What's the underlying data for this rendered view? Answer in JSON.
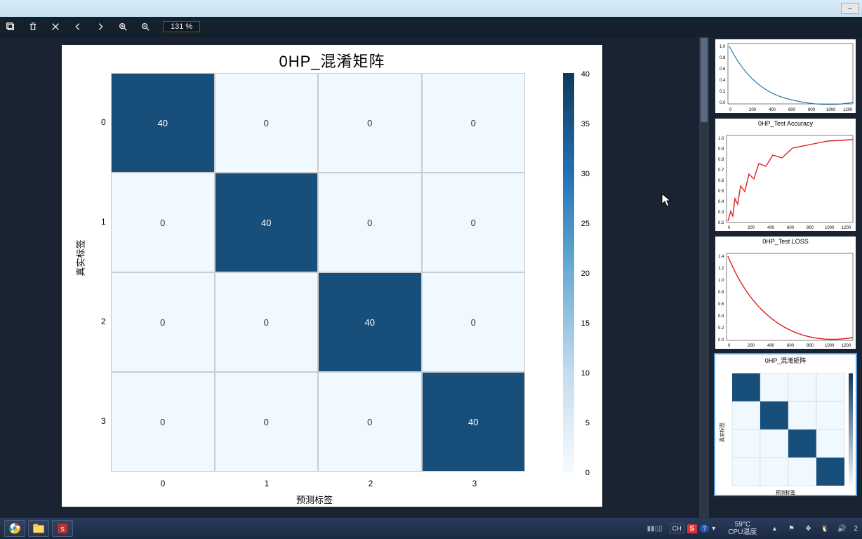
{
  "toolbar": {
    "zoom_text": "131 %"
  },
  "chart_data": {
    "type": "heatmap",
    "title": "0HP_混淆矩阵",
    "xlabel": "预测标签",
    "ylabel": "真实标签",
    "x_ticks": [
      "0",
      "1",
      "2",
      "3"
    ],
    "y_ticks": [
      "0",
      "1",
      "2",
      "3"
    ],
    "matrix": [
      [
        40,
        0,
        0,
        0
      ],
      [
        0,
        40,
        0,
        0
      ],
      [
        0,
        0,
        40,
        0
      ],
      [
        0,
        0,
        0,
        40
      ]
    ],
    "colorbar": {
      "ticks": [
        0,
        5,
        10,
        15,
        20,
        25,
        30,
        35,
        40
      ]
    }
  },
  "side_charts": [
    {
      "title": "",
      "type": "line",
      "color": "#2a7aae",
      "yticks": [
        "0.0",
        "0.2",
        "0.4",
        "0.6",
        "0.8",
        "1.0"
      ],
      "xticks": [
        "0",
        "200",
        "400",
        "600",
        "800",
        "1000",
        "1200"
      ],
      "note": "decaying curve (partially visible)"
    },
    {
      "title": "0HP_Test Accuracy",
      "type": "line",
      "color": "#e02020",
      "yticks": [
        "0.2",
        "0.3",
        "0.4",
        "0.5",
        "0.6",
        "0.7",
        "0.8",
        "0.9",
        "1.0"
      ],
      "xticks": [
        "0",
        "200",
        "400",
        "600",
        "800",
        "1000",
        "1200"
      ],
      "note": "rising curve approaching 1.0"
    },
    {
      "title": "0HP_Test LOSS",
      "type": "line",
      "color": "#e02020",
      "yticks": [
        "0.0",
        "0.2",
        "0.4",
        "0.6",
        "0.8",
        "1.0",
        "1.2",
        "1.4"
      ],
      "xticks": [
        "0",
        "200",
        "400",
        "600",
        "800",
        "1000",
        "1200"
      ],
      "note": "falling curve from ~1.4 toward 0"
    },
    {
      "title": "0HP_混淆矩阵",
      "type": "heatmap",
      "matrix": [
        [
          40,
          0,
          0,
          0
        ],
        [
          0,
          40,
          0,
          0
        ],
        [
          0,
          0,
          40,
          0
        ],
        [
          0,
          0,
          0,
          40
        ]
      ],
      "xlabel": "预测标签",
      "ylabel": "真实标签",
      "note": "selected thumbnail"
    }
  ],
  "taskbar": {
    "ime_lang": "CH",
    "temp_value": "59°C",
    "temp_label": "CPU温度",
    "digit_right": "2",
    "bar_empty": ""
  }
}
